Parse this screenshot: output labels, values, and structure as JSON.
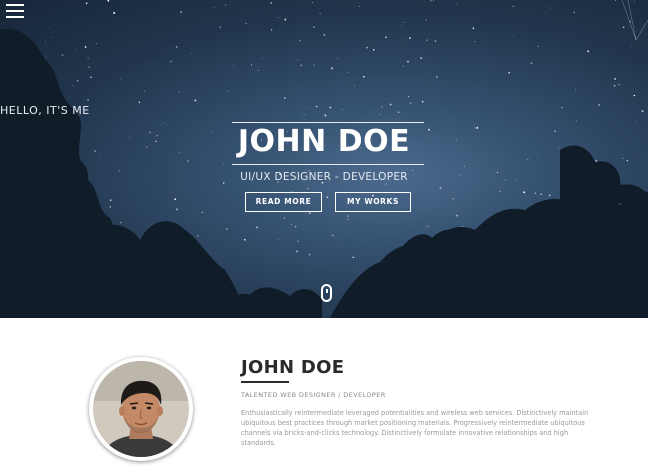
{
  "header": {
    "menu_icon": "hamburger-menu-icon"
  },
  "hero": {
    "greeting": "HELLO, IT'S ME",
    "name": "JOHN DOE",
    "role": "UI/UX DESIGNER - DEVELOPER",
    "buttons": {
      "read_more": "READ MORE",
      "my_works": "MY WORKS"
    },
    "scroll_icon": "mouse-scroll-icon"
  },
  "about": {
    "name": "JOHN DOE",
    "tagline": "TALENTED WEB DESIGNER / DEVELOPER",
    "bio": "Enthusiastically reintermediate leveraged potentialities and wireless web services. Distinctively maintain ubiquitous best practices through market positioning materials. Progressively reintermediate ubiquitous channels via bricks-and-clicks technology. Distinctively formulate innovative relationships and high standards."
  },
  "colors": {
    "hero_sky": "#2c4562",
    "text_white": "#ffffff",
    "heading_dark": "#2a2a2a",
    "body_grey": "#9a9a9a"
  }
}
